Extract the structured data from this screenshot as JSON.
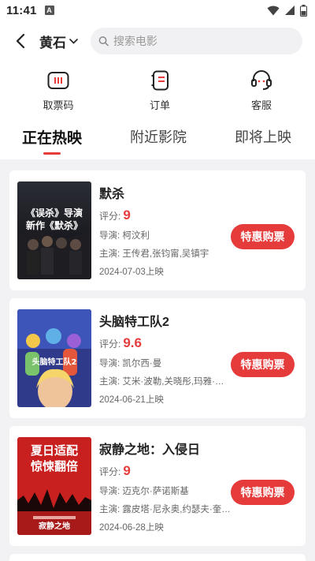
{
  "status": {
    "time": "11:41",
    "a_icon": "A"
  },
  "header": {
    "city": "黄石",
    "search_placeholder": "搜索电影"
  },
  "quick_actions": [
    {
      "label": "取票码",
      "icon": "ticket-code-icon"
    },
    {
      "label": "订单",
      "icon": "order-icon"
    },
    {
      "label": "客服",
      "icon": "headset-icon"
    }
  ],
  "tabs": [
    {
      "label": "正在热映",
      "active": true
    },
    {
      "label": "附近影院",
      "active": false
    },
    {
      "label": "即将上映",
      "active": false
    }
  ],
  "score_label": "评分:",
  "buy_label": "特惠购票",
  "movies": [
    {
      "title": "默杀",
      "score": "9",
      "director": "导演: 柯汶利",
      "cast": "主演: 王传君,张钧甯,吴镇宇",
      "date": "2024-07-03上映",
      "poster": {
        "line1": "《误杀》导演",
        "line2": "新作《默杀》"
      }
    },
    {
      "title": "头脑特工队2",
      "score": "9.6",
      "director": "导演: 凯尔西·曼",
      "cast": "主演: 艾米·波勒,关晓彤,玛雅·霍…",
      "date": "2024-06-21上映",
      "poster": {
        "line1": "头脑特工队2"
      }
    },
    {
      "title": "寂静之地：入侵日",
      "score": "9",
      "director": "导演: 迈克尔·萨诺斯基",
      "cast": "主演: 露皮塔·尼永奥,约瑟夫·奎…",
      "date": "2024-06-28上映",
      "poster": {
        "line1": "夏日适配",
        "line2": "惊悚翻倍",
        "line3": "寂静之地"
      }
    }
  ]
}
